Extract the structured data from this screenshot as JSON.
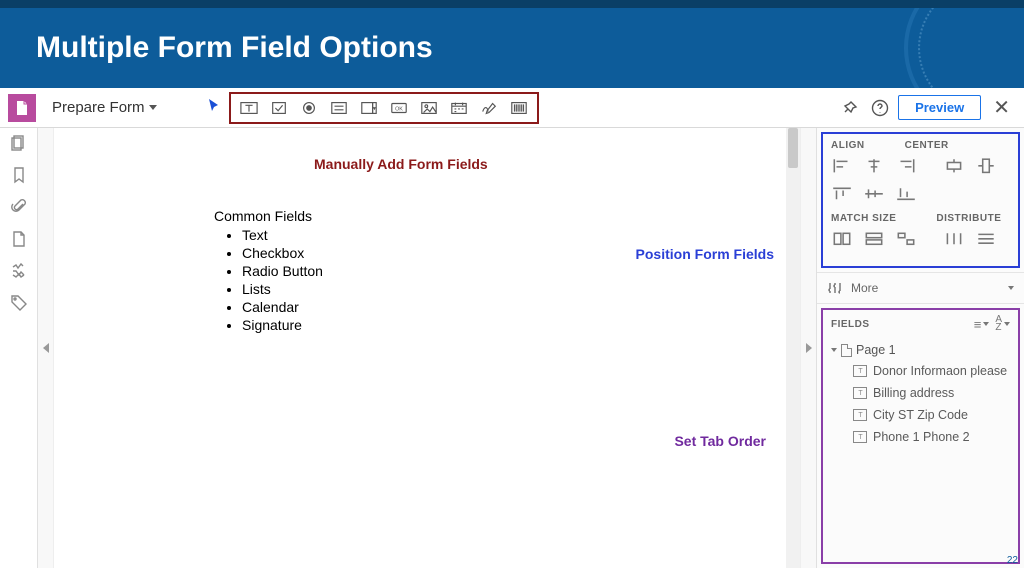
{
  "slide": {
    "title": "Multiple Form Field Options",
    "page_number": "22"
  },
  "toolbar": {
    "mode_label": "Prepare Form",
    "preview_label": "Preview"
  },
  "annotations": {
    "manual_add": "Manually Add Form Fields",
    "position": "Position Form Fields",
    "tab_order": "Set Tab Order"
  },
  "doc": {
    "heading": "Common Fields",
    "items": [
      "Text",
      "Checkbox",
      "Radio Button",
      "Lists",
      "Calendar",
      "Signature"
    ]
  },
  "right_panel": {
    "align": "ALIGN",
    "center": "CENTER",
    "match_size": "MATCH SIZE",
    "distribute": "DISTRIBUTE",
    "more": "More",
    "fields": "FIELDS",
    "az_label": "A/Z",
    "page_label": "Page 1",
    "field_items": [
      "Donor Informaon please",
      "Billing address",
      "City ST  Zip Code",
      "Phone 1  Phone 2"
    ]
  }
}
